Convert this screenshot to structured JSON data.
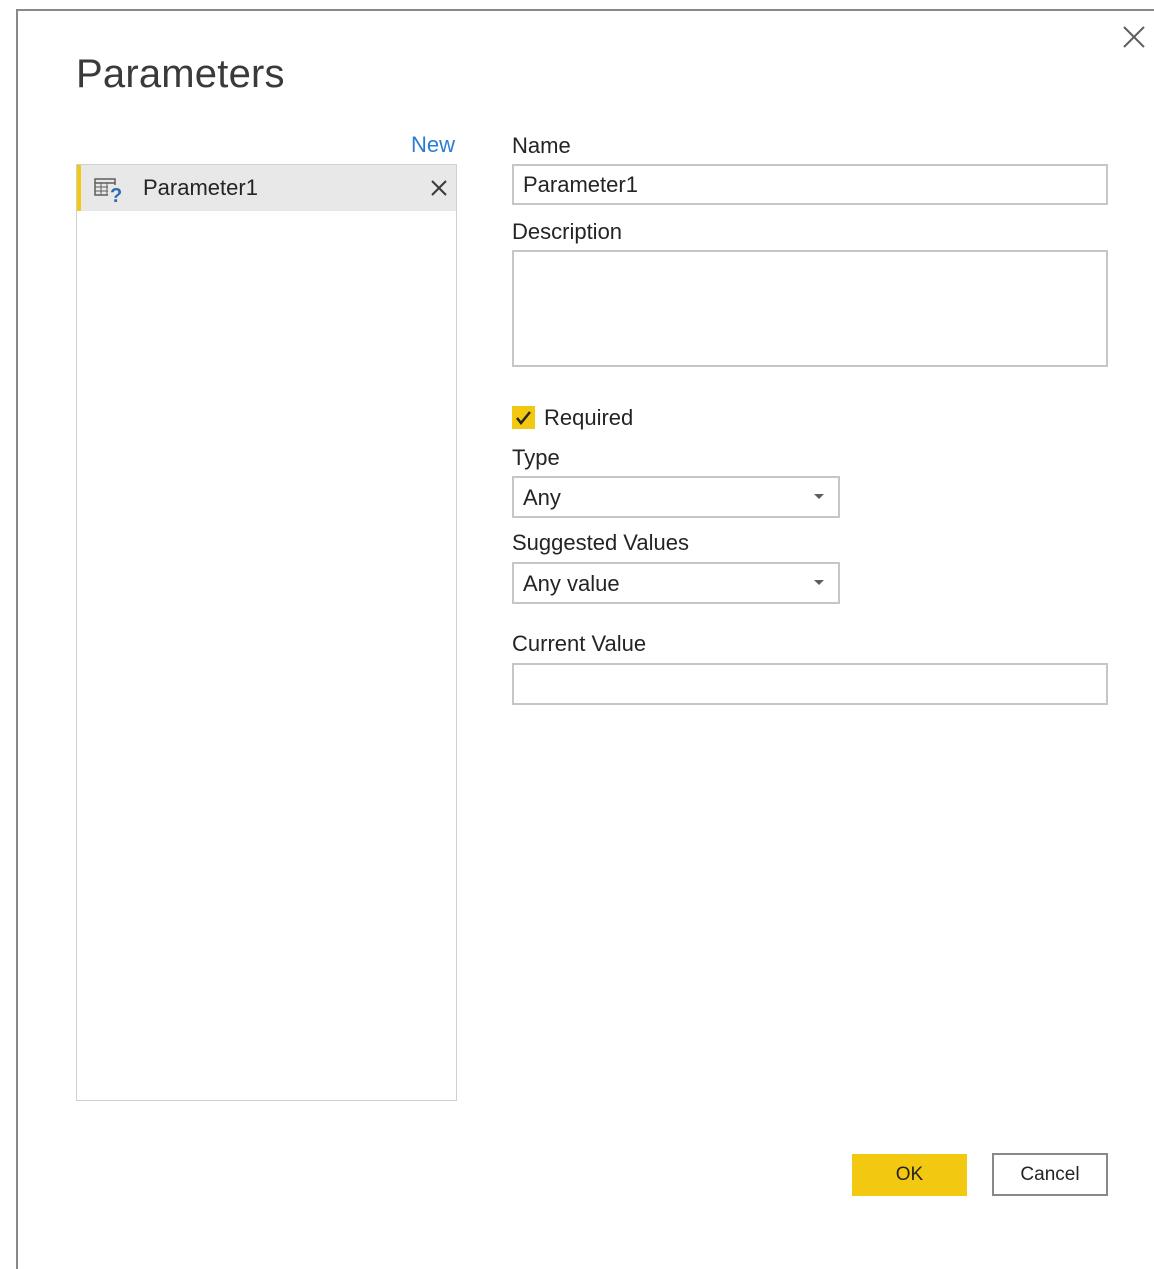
{
  "dialog": {
    "title": "Parameters",
    "close_icon": "close-icon"
  },
  "list": {
    "new_label": "New",
    "items": [
      {
        "label": "Parameter1",
        "icon": "parameter-table-icon",
        "delete_icon": "close-icon",
        "selected": true
      }
    ],
    "accent_color": "#f2c811"
  },
  "form": {
    "name_label": "Name",
    "name_value": "Parameter1",
    "description_label": "Description",
    "description_value": "",
    "required_label": "Required",
    "required_checked": true,
    "type_label": "Type",
    "type_value": "Any",
    "suggested_label": "Suggested Values",
    "suggested_value": "Any value",
    "current_label": "Current Value",
    "current_value": ""
  },
  "buttons": {
    "ok_label": "OK",
    "cancel_label": "Cancel",
    "ok_color": "#f2c811"
  }
}
